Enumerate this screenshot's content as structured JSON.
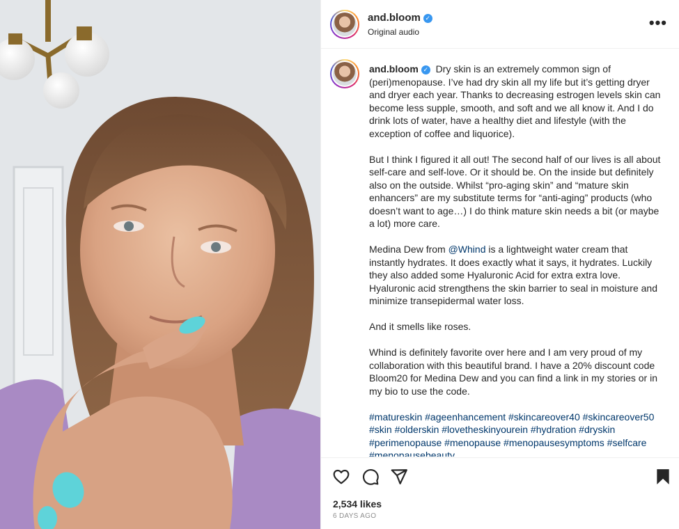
{
  "post": {
    "username": "and.bloom",
    "audio_label": "Original audio",
    "more_label": "•••",
    "verified_mark": "✓"
  },
  "caption": {
    "username": "and.bloom",
    "p1": "Dry skin is an extremely common sign of (peri)menopause. I’ve had dry skin all my life but it’s getting dryer and dryer each year. Thanks to decreasing estrogen levels skin can become less supple, smooth, and soft and we all know it. And I do drink lots of water, have a healthy diet and lifestyle (with the exception of coffee and liquorice).",
    "p2": "But I think I figured it all out! The second half of our lives is all about self-care and self-love. Or it should be. On the inside but definitely also on the outside. Whilst “pro-aging skin” and “mature skin enhancers” are my substitute terms for “anti-aging” products (who doesn’t want to age…) I do think mature skin needs a bit (or maybe a lot) more care.",
    "p3_before": "Medina Dew from ",
    "p3_mention": "@Whind",
    "p3_after": " is a lightweight water cream that instantly hydrates. It does exactly what it says, it hydrates. Luckily they also added some Hyaluronic Acid for extra extra love. Hyaluronic acid strengthens the skin barrier to seal in moisture and minimize transepidermal water loss.",
    "p4": "And it smells like roses.",
    "p5": "Whind is definitely favorite over here and I am very proud of my collaboration with this beautiful brand. I have a 20% discount code Bloom20 for Medina Dew and you can find a link in my stories or in my bio to use the code.",
    "hashtags": "#matureskin #ageenhancement #skincareover40 #skincareover50 #skin #olderskin #lovetheskinyourein #hydration #dryskin #perimenopause #menopause #menopausesymptoms #selfcare #menopausebeauty"
  },
  "actions": {
    "like_icon": "heart-icon",
    "comment_icon": "comment-icon",
    "share_icon": "paper-plane-icon",
    "save_icon": "bookmark-icon"
  },
  "stats": {
    "likes": "2,534 likes",
    "age": "6 DAYS AGO"
  },
  "colors": {
    "verified": "#3897f0",
    "link": "#00376b",
    "nail_polish": "#5ed3d9",
    "top": "#a98ac4"
  }
}
